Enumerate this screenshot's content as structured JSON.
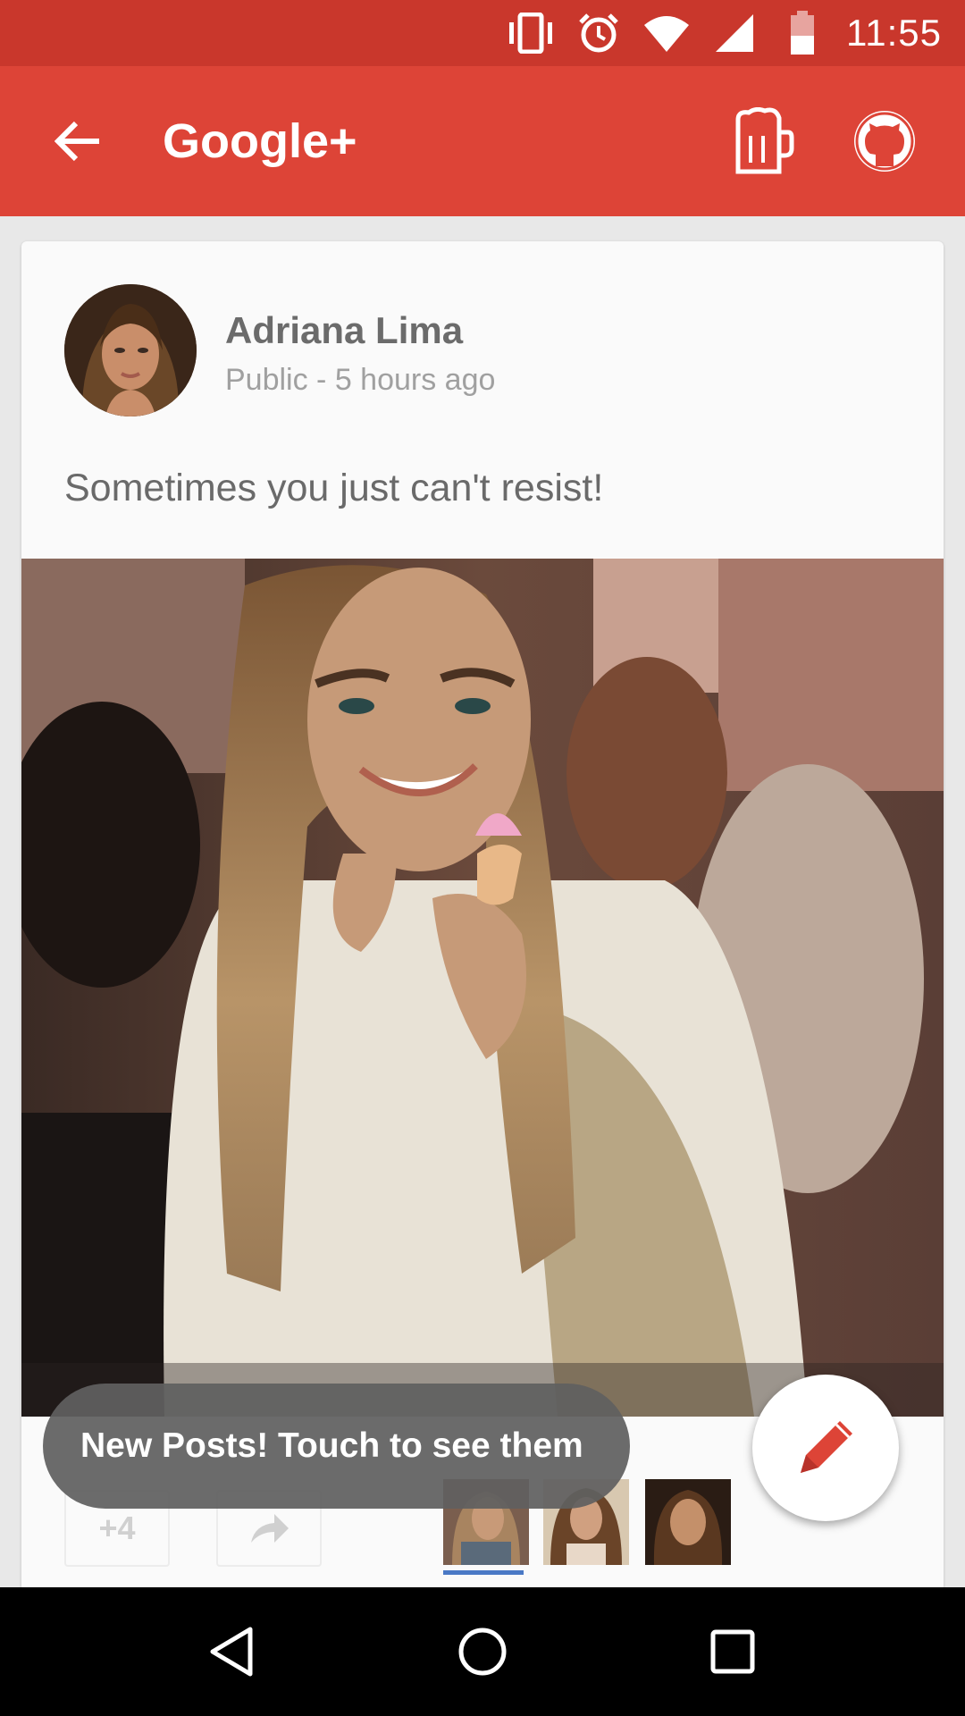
{
  "status_bar": {
    "time": "11:55",
    "icons": [
      "vibrate-icon",
      "alarm-icon",
      "wifi-icon",
      "signal-icon",
      "battery-icon"
    ]
  },
  "app_bar": {
    "title": "Google+",
    "actions": [
      "beer-mug-icon",
      "github-icon"
    ]
  },
  "post": {
    "author": "Adriana Lima",
    "meta": "Public - 5 hours ago",
    "text": "Sometimes you just can't resist!",
    "plus_count": "+4"
  },
  "toast": {
    "text": "New Posts! Touch to see them"
  },
  "colors": {
    "status_bar": "#c9372c",
    "app_bar": "#dd4437",
    "fab_icon": "#dd4437"
  },
  "nav_bar": {
    "buttons": [
      "back-triangle-icon",
      "home-circle-icon",
      "recents-square-icon"
    ]
  }
}
